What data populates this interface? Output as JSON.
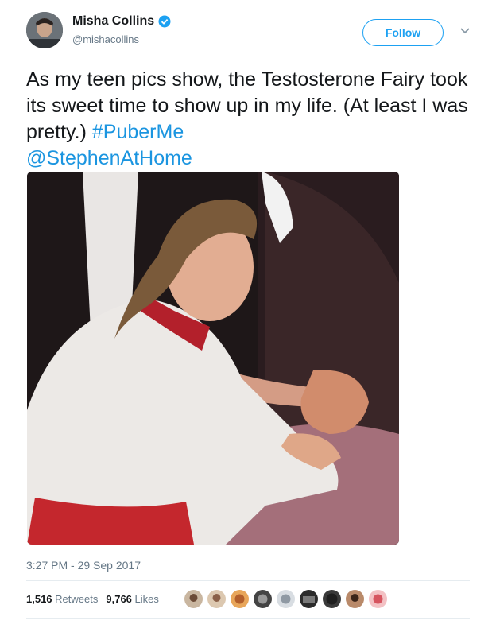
{
  "author": {
    "display_name": "Misha Collins",
    "handle": "@mishacollins",
    "verified": true
  },
  "actions": {
    "follow_label": "Follow"
  },
  "tweet": {
    "text": "As my teen pics show, the Testosterone Fairy took its sweet time to show up in my life. (At least I was pretty.) ",
    "hashtag": "#PuberMe",
    "mention": "@StephenAtHome",
    "timestamp": "3:27 PM - 29 Sep 2017"
  },
  "stats": {
    "retweets_count": "1,516",
    "retweets_label": "Retweets",
    "likes_count": "9,766",
    "likes_label": "Likes"
  },
  "icons": {
    "verified": "verified-badge-icon",
    "menu": "chevron-down-icon"
  },
  "colors": {
    "link": "#1b95e0",
    "accent": "#1da1f2",
    "secondary_text": "#657786"
  }
}
